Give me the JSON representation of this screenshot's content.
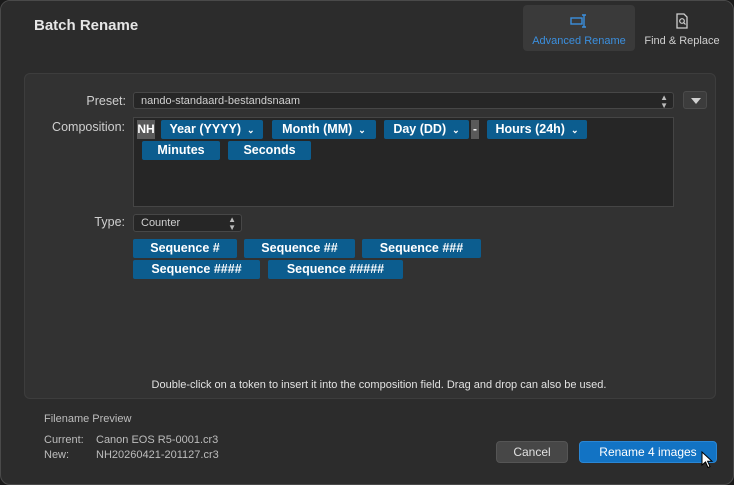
{
  "window": {
    "title": "Batch Rename"
  },
  "modes": [
    {
      "label": "Advanced Rename",
      "icon": "advanced-rename-icon",
      "active": true
    },
    {
      "label": "Find & Replace",
      "icon": "find-replace-icon",
      "active": false
    }
  ],
  "form": {
    "preset_label": "Preset:",
    "preset_value": "nando-standaard-bestandsnaam",
    "composition_label": "Composition:",
    "type_label": "Type:",
    "type_value": "Counter"
  },
  "composition": {
    "literal_1": "NH",
    "literal_2": "-",
    "tokens": [
      "Year (YYYY)",
      "Month (MM)",
      "Day (DD)",
      "Hours (24h)",
      "Minutes",
      "Seconds"
    ]
  },
  "sequence_tokens": [
    "Sequence #",
    "Sequence ##",
    "Sequence ###",
    "Sequence ####",
    "Sequence #####"
  ],
  "hint": "Double-click on a token to insert it into the composition field. Drag and drop can also be used.",
  "preview": {
    "title": "Filename Preview",
    "current_label": "Current:",
    "current_value": "Canon EOS R5-0001.cr3",
    "new_label": "New:",
    "new_value": "NH20260421-201127.cr3"
  },
  "buttons": {
    "cancel": "Cancel",
    "rename": "Rename 4 images"
  },
  "colors": {
    "token_bg": "#0c5d8f",
    "accent": "#3b8fde",
    "primary_button": "#1273c4"
  }
}
